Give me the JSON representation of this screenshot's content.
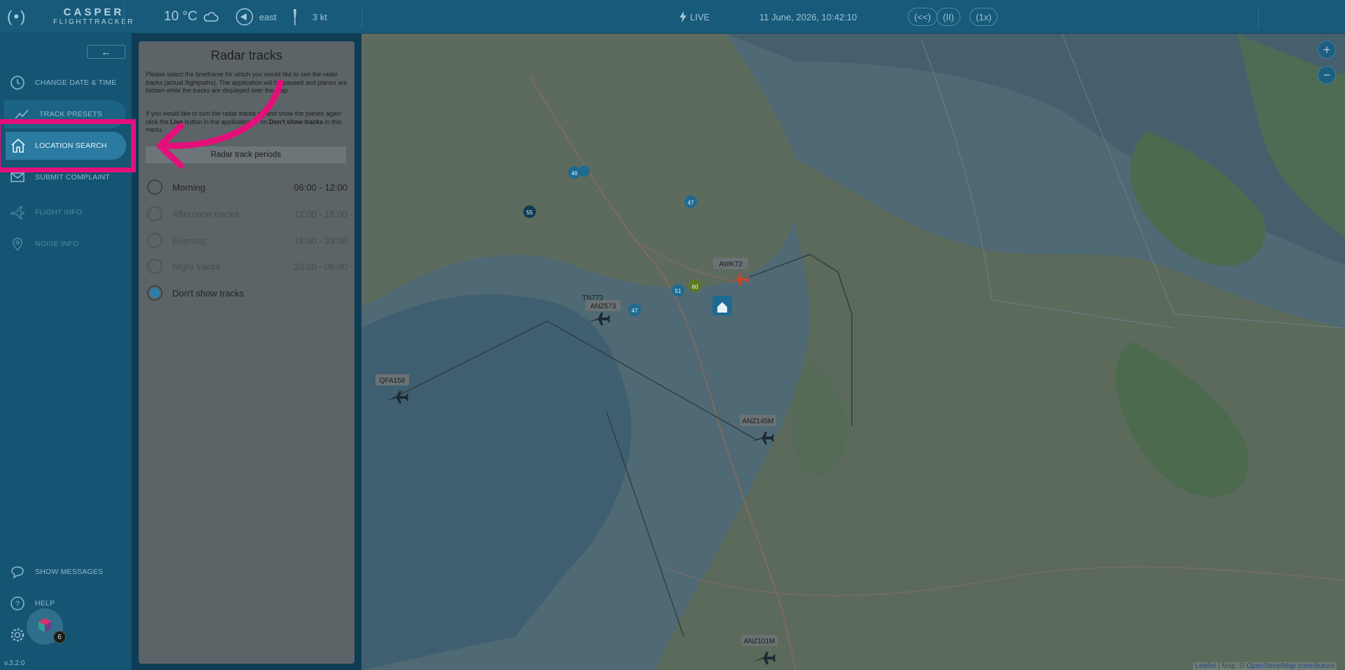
{
  "topbar": {
    "logo_mark": "(•)",
    "logo_line1": "CASPER",
    "logo_line2": "FLIGHTTRACKER",
    "temperature": "10 °C",
    "wind_direction": "east",
    "wind_speed": "3 kt",
    "live_label": "LIVE",
    "datetime": "11 June, 2026, 10:42:10",
    "rewind_label": "(<<)",
    "pause_label": "(II)",
    "speed_label": "(1x)",
    "icons": [
      "cloud-icon",
      "wind-direction-icon",
      "windsock-icon",
      "lightning-icon"
    ]
  },
  "sidebar": {
    "collapse_icon": "arrow-left-icon",
    "items": [
      {
        "label": "CHANGE DATE & TIME",
        "icon": "clock-icon"
      },
      {
        "label": "TRACK PRESETS",
        "icon": "chart-line-icon"
      },
      {
        "label": "LOCATION SEARCH",
        "icon": "home-icon"
      },
      {
        "label": "SUBMIT COMPLAINT",
        "icon": "envelope-icon"
      },
      {
        "label": "FLIGHT INFO",
        "icon": "plane-icon"
      },
      {
        "label": "NOISE INFO",
        "icon": "location-pin-icon"
      },
      {
        "label": "SHOW MESSAGES",
        "icon": "chat-icon"
      },
      {
        "label": "HELP",
        "icon": "help-icon"
      }
    ],
    "settings_icon": "gear-icon",
    "chat_badge": "6",
    "version": "v.3.2.0"
  },
  "panel": {
    "title": "Radar tracks",
    "paragraph1": "Please select the timeframe for which you would like to see the rader tracks (actual flightpaths). The application will be paused and planes are hidden while the tracks are displayed over the map.",
    "paragraph2_part1": "If you would like to turn the radar tracks off and show the planes again click the ",
    "paragraph2_live": "Live",
    "paragraph2_part2": " button in the application or on ",
    "paragraph2_dont": "Don't show tracks",
    "paragraph2_part3": " in this menu.",
    "periods_header": "Radar track periods",
    "periods": [
      {
        "label": "Morning",
        "time": "06:00 - 12:00",
        "selected": false
      },
      {
        "label": "Afternoon tracks",
        "time": "12:00 - 18:00",
        "selected": false
      },
      {
        "label": "Evening",
        "time": "18:00 - 23:00",
        "selected": false
      },
      {
        "label": "Night tracks",
        "time": "23:00 - 06:00",
        "selected": false
      },
      {
        "label": "Don't show tracks",
        "time": "",
        "selected": true
      }
    ]
  },
  "map": {
    "flights": [
      "AWK72",
      "ANZ573",
      "TN773",
      "QFA158",
      "ANZ145M",
      "ANZ101M"
    ],
    "markers": [
      "46",
      "55",
      "47",
      "51",
      "60",
      "47"
    ],
    "zoom_in": "+",
    "zoom_out": "−",
    "attribution_leaflet": "Leaflet",
    "attribution_sep": " | Map: © ",
    "attribution_osm": "OpenStreetMap contributors"
  },
  "colors": {
    "topbar": "#175a7a",
    "sidebar": "#155573",
    "active_item": "#2b7aa1",
    "highlight": "#e4107a",
    "panel": "#5c6468"
  }
}
